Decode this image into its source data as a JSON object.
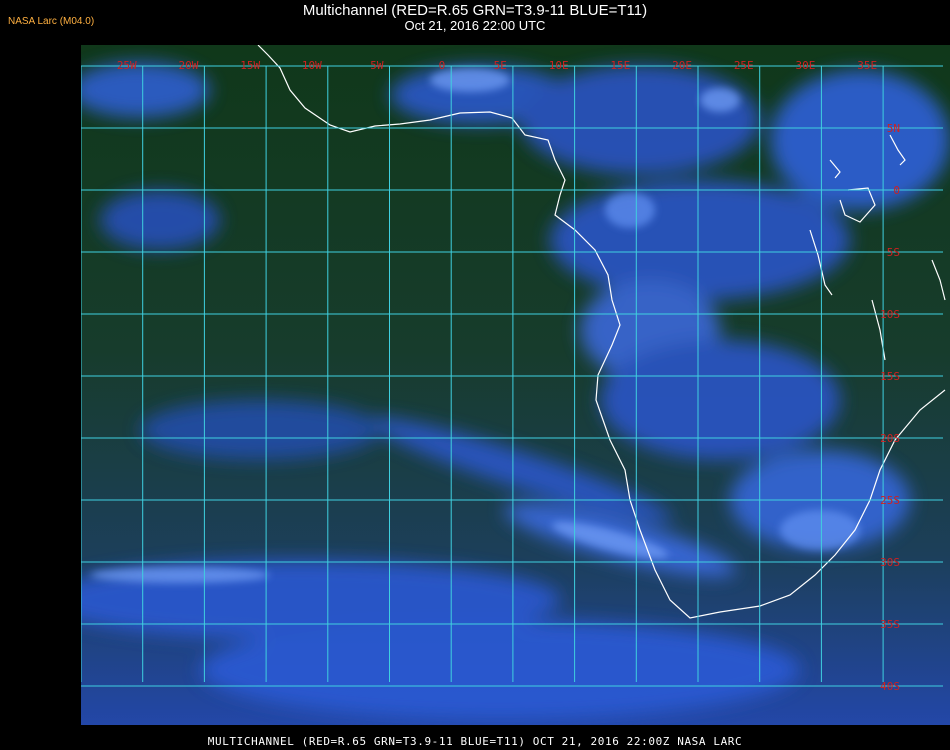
{
  "header": {
    "title": "Multichannel (RED=R.65 GRN=T3.9-11 BLUE=T11)",
    "subtitle": "Oct 21, 2016 22:00 UTC",
    "credit": "NASA Larc (M04.0)"
  },
  "footer": {
    "caption": "MULTICHANNEL (RED=R.65 GRN=T3.9-11 BLUE=T11) OCT 21, 2016 22:00Z  NASA LARC"
  },
  "map": {
    "lon_labels": [
      "25W",
      "20W",
      "15W",
      "10W",
      "5W",
      "0",
      "5E",
      "10E",
      "15E",
      "20E",
      "25E",
      "30E",
      "35E"
    ],
    "lat_labels": [
      "5N",
      "0",
      "5S",
      "10S",
      "15S",
      "20S",
      "25S",
      "30S",
      "35S",
      "40S"
    ],
    "colors": {
      "grid": "#3fd0e0",
      "label": "#d02020",
      "coast": "#ffffff",
      "land_ocean_green": "#163d12",
      "cloud_blue": "#2a56c8",
      "bright_cloud": "#7fb0ff"
    }
  }
}
